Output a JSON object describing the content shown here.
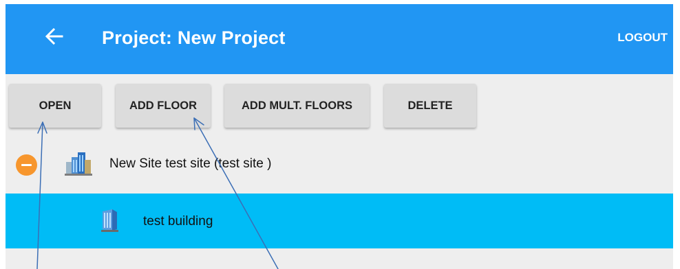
{
  "appbar": {
    "back_icon": "arrow-left-icon",
    "title": "Project: New Project",
    "logout_label": "LOGOUT",
    "color": "#2196f3"
  },
  "toolbar": {
    "open_label": "OPEN",
    "add_floor_label": "ADD FLOOR",
    "add_mult_floors_label": "ADD MULT. FLOORS",
    "delete_label": "DELETE"
  },
  "tree": {
    "site": {
      "label": "New Site test site  (test site )",
      "collapse_icon": "minus-circle-icon",
      "icon": "buildings-icon"
    },
    "building": {
      "label": "test building",
      "icon": "building-icon",
      "selected": true,
      "highlight_color": "#00bcf6"
    }
  },
  "colors": {
    "background": "#eeeeee",
    "button": "#dcdcdc",
    "collapse": "#f7962d",
    "annotation": "#3b6eb5"
  }
}
